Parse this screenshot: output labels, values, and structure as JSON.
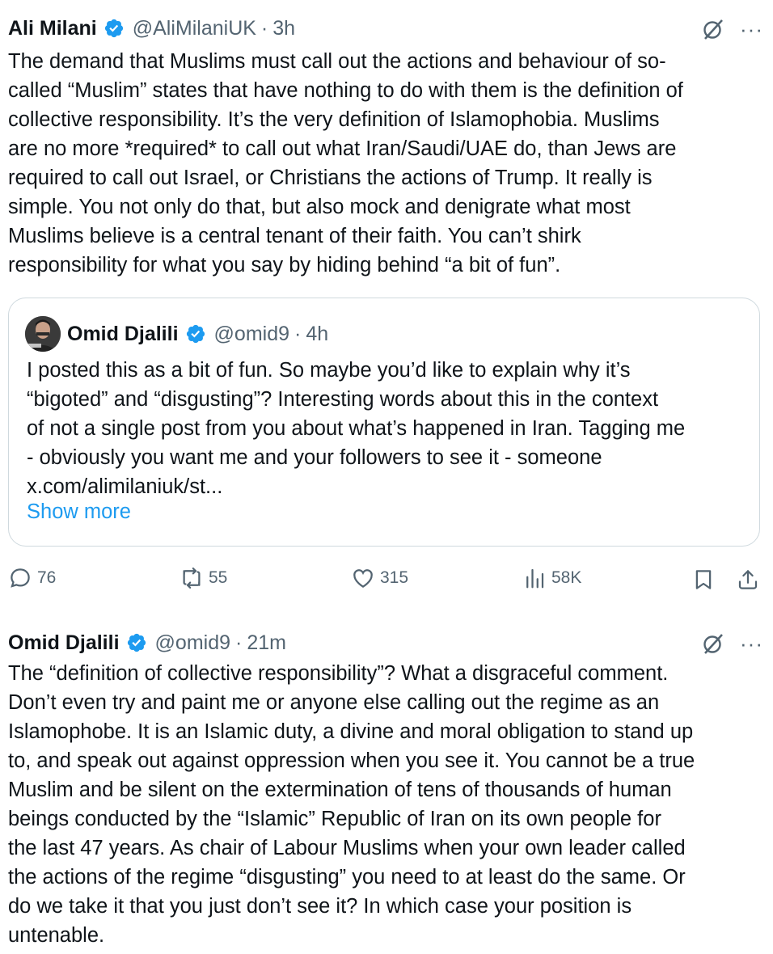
{
  "tweet1": {
    "name": "Ali Milani",
    "handle": "@AliMilaniUK",
    "separator": "·",
    "time": "3h",
    "more": "···",
    "lines": [
      "The demand that Muslims must call out the actions and behaviour of so-",
      "called “Muslim” states that have nothing to do with them is the definition of",
      "collective responsibility. It’s the very definition of Islamophobia. Muslims",
      "are no more *required* to call out what Iran/Saudi/UAE do, than Jews are",
      "required to call out Israel, or Christians the actions of Trump. It really is",
      "simple. You not only do that, but also mock and denigrate what most",
      "Muslims believe is a central tenant of their faith. You can’t shirk",
      "responsibility for what you say by hiding behind “a bit of fun”."
    ],
    "quote": {
      "name": "Omid Djalili",
      "handle": "@omid9",
      "separator": "·",
      "time": "4h",
      "lines": [
        "I posted this as a bit of fun. So maybe you’d like to explain why it’s",
        "“bigoted” and “disgusting”? Interesting words about this in the context",
        "of not a single post from you about what’s happened in Iran. Tagging me",
        "- obviously you want me and your followers to see it - someone",
        "x.com/alimilaniuk/st..."
      ],
      "show_more": "Show more"
    },
    "stats": {
      "replies": "76",
      "reposts": "55",
      "likes": "315",
      "views": "58K"
    }
  },
  "tweet2": {
    "name": "Omid Djalili",
    "handle": "@omid9",
    "separator": "·",
    "time": "21m",
    "more": "···",
    "lines": [
      "The “definition of collective responsibility”? What a disgraceful comment.",
      "Don’t even try and paint me or anyone else calling out the regime as an",
      "Islamophobe. It is an Islamic duty, a divine and moral obligation to stand up",
      "to, and speak out against oppression when you see it. You cannot be a true",
      "Muslim and be silent on the extermination of tens of thousands of human",
      "beings conducted by the “Islamic” Republic of Iran on its own people for",
      "the last 47 years. As chair of Labour Muslims when your own leader called",
      "the actions of the regime “disgusting” you need to at least do the same. Or",
      "do we take it that you just don’t see it? In which case your position is",
      "untenable."
    ]
  },
  "colors": {
    "text": "#0f1419",
    "secondary": "#536471",
    "accent": "#1d9bf0",
    "border": "#cfd9de"
  }
}
